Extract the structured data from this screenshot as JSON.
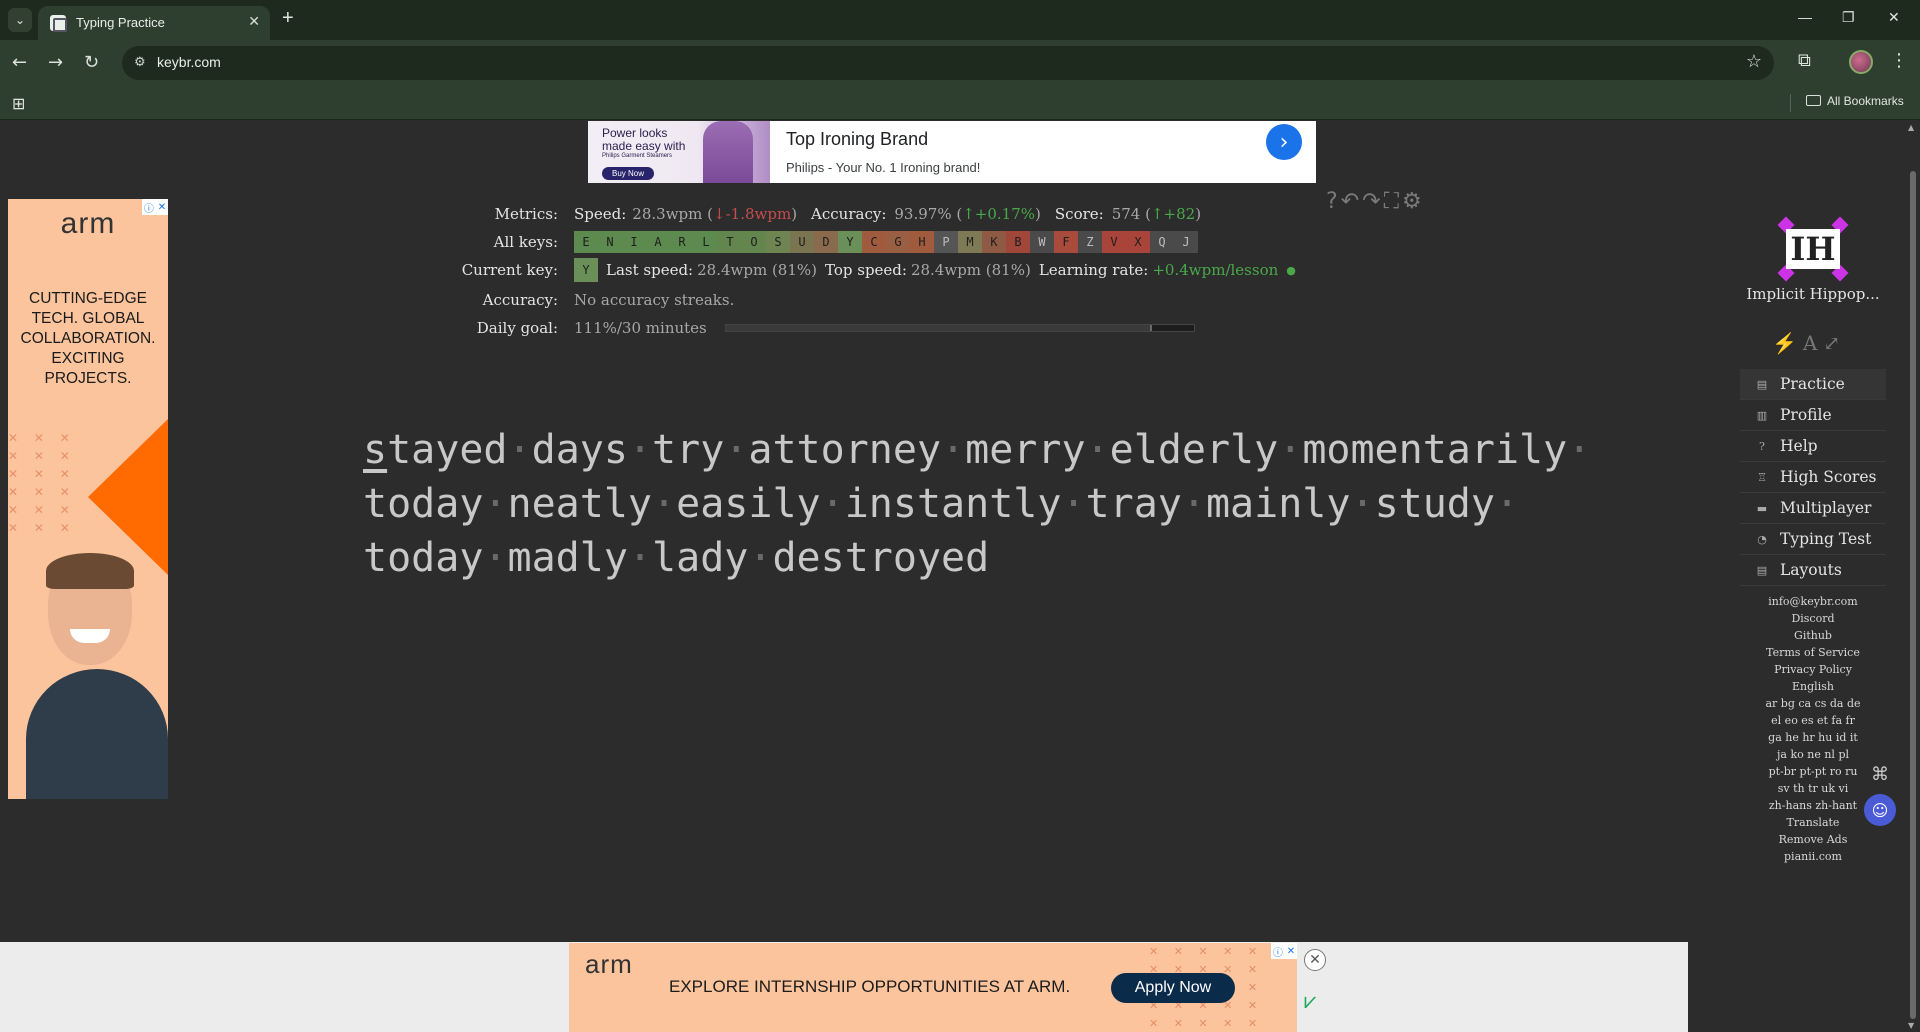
{
  "browser": {
    "tab_title": "Typing Practice",
    "url": "keybr.com",
    "all_bookmarks": "All Bookmarks"
  },
  "top_ad": {
    "img_text": "Power looks made easy with",
    "img_small": "Philips Garment Steamers",
    "img_button": "Buy Now",
    "headline": "Top Ironing Brand",
    "subtext": "Philips - Your No. 1 Ironing brand!"
  },
  "left_ad": {
    "logo": "arm",
    "copy": "CUTTING-EDGE TECH. GLOBAL COLLABORATION. EXCITING PROJECTS."
  },
  "metrics": {
    "metrics_label": "Metrics:",
    "speed_label": "Speed:",
    "speed_value": "28.3wpm",
    "speed_delta_open": "(",
    "speed_delta": "↓-1.8wpm",
    "speed_delta_close": ")",
    "accuracy_label": "Accuracy:",
    "accuracy_value": "93.97%",
    "accuracy_delta": "↑+0.17%",
    "score_label": "Score:",
    "score_value": "574",
    "score_delta": "↑+82",
    "all_keys_label": "All keys:",
    "current_key_label": "Current key:",
    "current_key": "Y",
    "last_speed_label": "Last speed:",
    "last_speed_value": "28.4wpm (81%)",
    "top_speed_label": "Top speed:",
    "top_speed_value": "28.4wpm (81%)",
    "learning_rate_label": "Learning rate:",
    "learning_rate_value": "+0.4wpm/lesson",
    "accuracy_row_label": "Accuracy:",
    "accuracy_row_value": "No accuracy streaks.",
    "daily_goal_label": "Daily goal:",
    "daily_goal_value": "111%/30 minutes",
    "daily_goal_progress": 0.91
  },
  "keys": [
    {
      "k": "E",
      "c": "#5d8a4e"
    },
    {
      "k": "N",
      "c": "#5d8a4e"
    },
    {
      "k": "I",
      "c": "#5d8a4e"
    },
    {
      "k": "A",
      "c": "#5d8a4e"
    },
    {
      "k": "R",
      "c": "#5d8a4e"
    },
    {
      "k": "L",
      "c": "#5d8a4e"
    },
    {
      "k": "T",
      "c": "#63864f"
    },
    {
      "k": "O",
      "c": "#63864f"
    },
    {
      "k": "S",
      "c": "#6e8451"
    },
    {
      "k": "U",
      "c": "#7a7550"
    },
    {
      "k": "D",
      "c": "#8a6a4c"
    },
    {
      "k": "Y",
      "c": "#6b8f58"
    },
    {
      "k": "C",
      "c": "#a05a3e"
    },
    {
      "k": "G",
      "c": "#9a5f43"
    },
    {
      "k": "H",
      "c": "#a05a3e"
    },
    {
      "k": "P",
      "c": "#555555"
    },
    {
      "k": "M",
      "c": "#7d7a55"
    },
    {
      "k": "K",
      "c": "#8e5a44"
    },
    {
      "k": "B",
      "c": "#a0473a"
    },
    {
      "k": "W",
      "c": "#4a4a4a"
    },
    {
      "k": "F",
      "c": "#a84a3c"
    },
    {
      "k": "Z",
      "c": "#4a4a4a"
    },
    {
      "k": "V",
      "c": "#a8443a"
    },
    {
      "k": "X",
      "c": "#a8443a"
    },
    {
      "k": "Q",
      "c": "#4a4a4a"
    },
    {
      "k": "J",
      "c": "#4a4a4a"
    }
  ],
  "typing_lines": [
    [
      "stayed",
      "days",
      "try",
      "attorney",
      "merry",
      "elderly",
      "momentarily"
    ],
    [
      "today",
      "neatly",
      "easily",
      "instantly",
      "tray",
      "mainly",
      "study"
    ],
    [
      "today",
      "madly",
      "lady",
      "destroyed"
    ]
  ],
  "sidebar": {
    "user_initials": "IH",
    "user_name": "Implicit Hippop...",
    "menu": [
      {
        "label": "Practice",
        "icon": "keyboard-icon",
        "glyph": "▤",
        "active": true
      },
      {
        "label": "Profile",
        "icon": "chart-icon",
        "glyph": "▥"
      },
      {
        "label": "Help",
        "icon": "help-icon",
        "glyph": "?"
      },
      {
        "label": "High Scores",
        "icon": "trophy-icon",
        "glyph": "♖"
      },
      {
        "label": "Multiplayer",
        "icon": "car-icon",
        "glyph": "▬"
      },
      {
        "label": "Typing Test",
        "icon": "gauge-icon",
        "glyph": "◔"
      },
      {
        "label": "Layouts",
        "icon": "layout-icon",
        "glyph": "▤"
      }
    ],
    "links": [
      "info@keybr.com",
      "Discord",
      "Github",
      "Terms of Service",
      "Privacy Policy",
      "English",
      "ar bg ca cs da de",
      "el eo es et fa fr",
      "ga he hr hu id it",
      "ja ko ne nl pl",
      "pt-br pt-pt ro ru",
      "sv th tr uk vi",
      "zh-hans zh-hant",
      "Translate",
      "Remove Ads",
      "pianii.com"
    ]
  },
  "bottom_ad": {
    "logo": "arm",
    "copy": "EXPLORE INTERNSHIP OPPORTUNITIES AT ARM.",
    "button": "Apply Now"
  }
}
